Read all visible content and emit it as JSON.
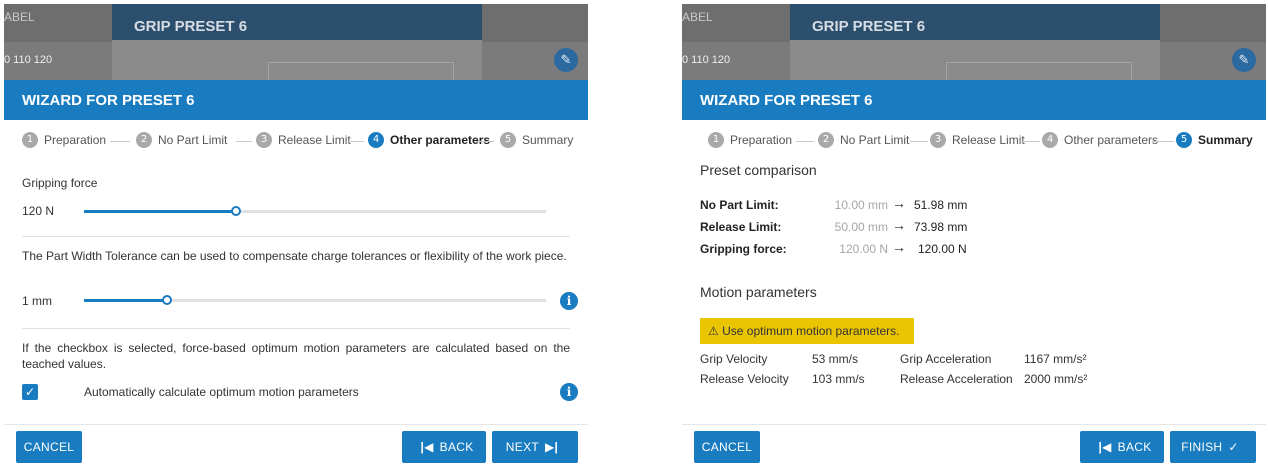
{
  "background": {
    "label_fragment": "ABEL",
    "number_fragment": "0 110 120",
    "title": "GRIP PRESET 6"
  },
  "colors": {
    "accent": "#1a7cc0",
    "warning": "#e9c400",
    "muted_text": "#a6a6a6"
  },
  "icons": {
    "edit": "pencil-icon",
    "info": "info-icon",
    "warning": "warning-triangle-icon",
    "checkbox": "check-icon",
    "back": "skip-back-icon",
    "next": "skip-forward-icon",
    "finish": "check-icon"
  },
  "wizard": {
    "title": "WIZARD FOR PRESET 6",
    "steps": [
      {
        "num": "1",
        "label": "Preparation"
      },
      {
        "num": "2",
        "label": "No Part Limit"
      },
      {
        "num": "3",
        "label": "Release Limit"
      },
      {
        "num": "4",
        "label": "Other parameters"
      },
      {
        "num": "5",
        "label": "Summary"
      }
    ]
  },
  "left": {
    "active_step": 4,
    "gripping_force_label": "Gripping force",
    "gripping_force_value": "120 N",
    "gripping_force_level": 0.33,
    "tolerance_text": "The Part Width Tolerance can be used to compensate charge tolerances or flexibility of the work piece.",
    "tolerance_value": "1 mm",
    "tolerance_level": 0.18,
    "checkbox_text": "If the checkbox is selected, force-based optimum motion parameters are calculated based on the teached values.",
    "checkbox_checked": true,
    "checkbox_label": "Automatically calculate optimum motion parameters",
    "cancel_label": "CANCEL",
    "back_label": "BACK",
    "next_label": "NEXT"
  },
  "right": {
    "active_step": 5,
    "comparison_title": "Preset comparison",
    "comparison": [
      {
        "label": "No Part Limit:",
        "old": "10.00 mm",
        "new": "51.98 mm"
      },
      {
        "label": "Release Limit:",
        "old": "50.00 mm",
        "new": "73.98 mm"
      },
      {
        "label": "Gripping force:",
        "old": "120.00 N",
        "new": "120.00 N"
      }
    ],
    "motion_title": "Motion parameters",
    "warning_text": "Use optimum motion parameters.",
    "motion": [
      {
        "label": "Grip Velocity",
        "value": "53 mm/s",
        "label2": "Grip Acceleration",
        "value2": "1167 mm/s²"
      },
      {
        "label": "Release Velocity",
        "value": "103 mm/s",
        "label2": "Release Acceleration",
        "value2": "2000 mm/s²"
      }
    ],
    "cancel_label": "CANCEL",
    "back_label": "BACK",
    "finish_label": "FINISH"
  }
}
